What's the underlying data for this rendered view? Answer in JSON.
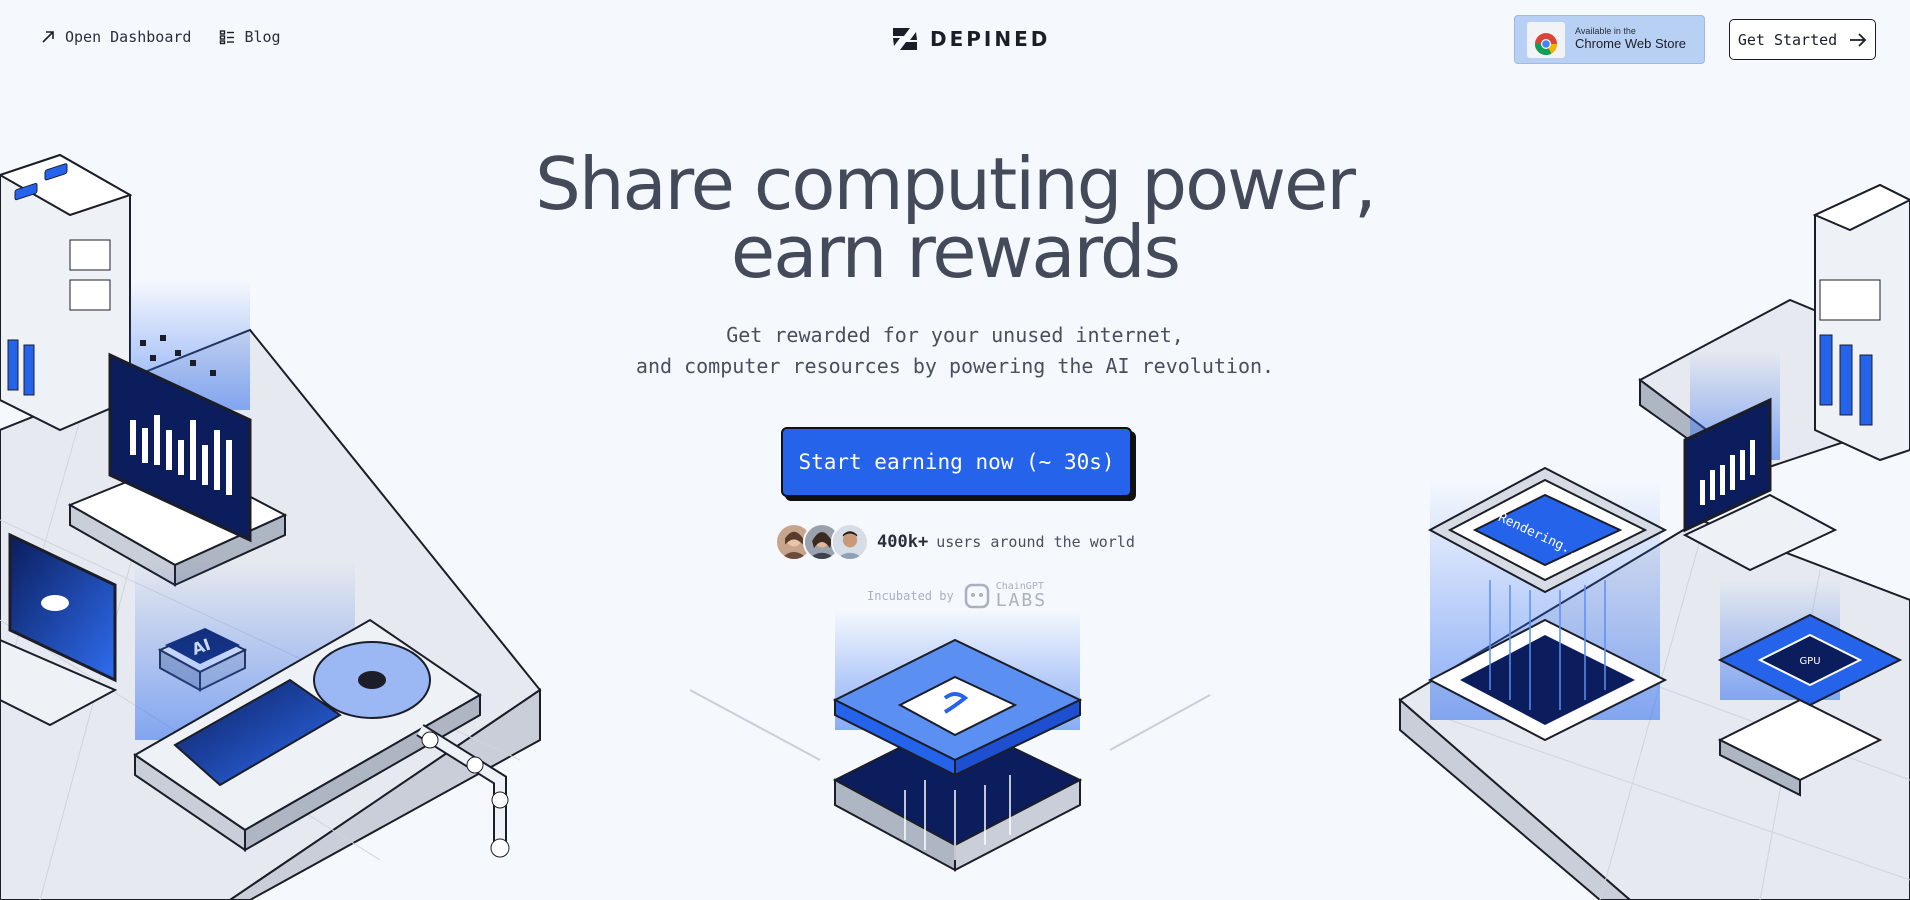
{
  "nav": {
    "open_dashboard": "Open Dashboard",
    "blog": "Blog"
  },
  "logo": {
    "text": "DEPINED"
  },
  "chrome_store": {
    "small": "Available in the",
    "big": "Chrome Web Store"
  },
  "get_started": "Get Started",
  "hero": {
    "line1": "Share computing power,",
    "line2": "earn rewards",
    "sub1": "Get rewarded for your unused internet,",
    "sub2": "and computer resources by powering the AI revolution."
  },
  "cta": "Start earning now (~ 30s)",
  "users": {
    "count": "400k+",
    "text": "users around the world"
  },
  "incubated": {
    "label": "Incubated by",
    "brand_small": "ChainGPT",
    "brand_big": "LABS"
  },
  "illustration": {
    "ai_chip_label": "AI",
    "rendering_label": "Rendering...",
    "gpu_label": "GPU"
  },
  "colors": {
    "accent": "#2563eb",
    "background": "#f5f8fd",
    "text": "#454a5a"
  }
}
